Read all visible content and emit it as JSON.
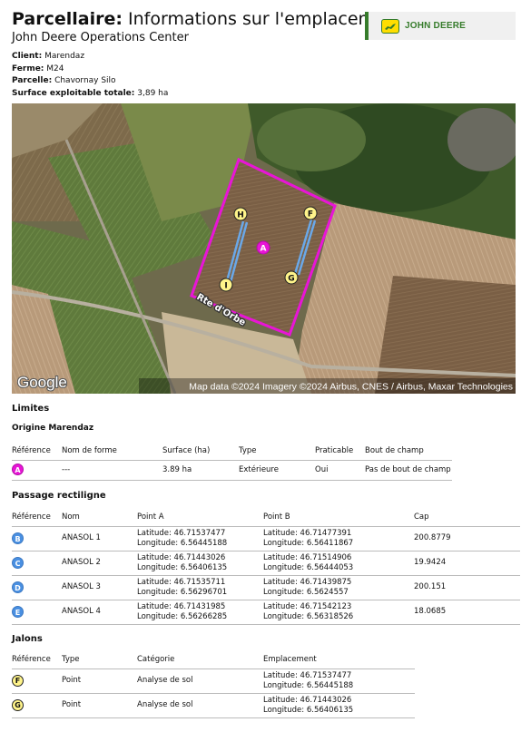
{
  "header": {
    "title_bold": "Parcellaire:",
    "title_rest": " Informations sur l'emplaceme",
    "subtitle": "John Deere Operations Center",
    "logo_text": "JOHN DEERE"
  },
  "meta": {
    "client_label": "Client:",
    "client": "Marendaz",
    "farm_label": "Ferme:",
    "farm": "M24",
    "field_label": "Parcelle:",
    "field": "Chavornay Silo",
    "area_label": "Surface exploitable totale:",
    "area": "3,89 ha"
  },
  "map": {
    "road_label": "Rte d'Orbe",
    "google": "Google",
    "attribution": "Map data ©2024 Imagery ©2024 Airbus, CNES / Airbus, Maxar Technologies",
    "markers": {
      "A": "A",
      "F": "F",
      "G": "G",
      "H": "H",
      "I": "I"
    },
    "boundary_color": "#e815d6",
    "line_color": "#6aa8e8"
  },
  "limites": {
    "title": "Limites",
    "subtitle": "Origine Marendaz",
    "headers": [
      "Référence",
      "Nom de forme",
      "Surface (ha)",
      "Type",
      "Praticable",
      "Bout de champ"
    ],
    "rows": [
      {
        "ref": "A",
        "name": "---",
        "surface": "3.89 ha",
        "type": "Extérieure",
        "praticable": "Oui",
        "bout": "Pas de bout de champ"
      }
    ]
  },
  "passage": {
    "title": "Passage rectiligne",
    "headers": [
      "Référence",
      "Nom",
      "Point A",
      "Point B",
      "Cap"
    ],
    "rows": [
      {
        "ref": "B",
        "name": "ANASOL 1",
        "a_lat": "Latitude: 46.71537477",
        "a_lon": "Longitude: 6.56445188",
        "b_lat": "Latitude: 46.71477391",
        "b_lon": "Longitude: 6.56411867",
        "cap": "200.8779"
      },
      {
        "ref": "C",
        "name": "ANASOL 2",
        "a_lat": "Latitude: 46.71443026",
        "a_lon": "Longitude: 6.56406135",
        "b_lat": "Latitude: 46.71514906",
        "b_lon": "Longitude: 6.56444053",
        "cap": "19.9424"
      },
      {
        "ref": "D",
        "name": "ANASOL 3",
        "a_lat": "Latitude: 46.71535711",
        "a_lon": "Longitude: 6.56296701",
        "b_lat": "Latitude: 46.71439875",
        "b_lon": "Longitude: 6.5624557",
        "cap": "200.151"
      },
      {
        "ref": "E",
        "name": "ANASOL 4",
        "a_lat": "Latitude: 46.71431985",
        "a_lon": "Longitude: 6.56266285",
        "b_lat": "Latitude: 46.71542123",
        "b_lon": "Longitude: 6.56318526",
        "cap": "18.0685"
      }
    ]
  },
  "jalons": {
    "title": "Jalons",
    "headers": [
      "Référence",
      "Type",
      "Catégorie",
      "Emplacement"
    ],
    "rows": [
      {
        "ref": "F",
        "type": "Point",
        "cat": "Analyse de sol",
        "lat": "Latitude: 46.71537477",
        "lon": "Longitude: 6.56445188"
      },
      {
        "ref": "G",
        "type": "Point",
        "cat": "Analyse de sol",
        "lat": "Latitude: 46.71443026",
        "lon": "Longitude: 6.56406135"
      }
    ]
  }
}
